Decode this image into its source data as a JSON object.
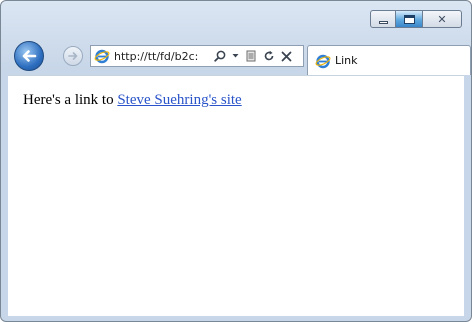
{
  "browser": {
    "address": {
      "url": "http://tt/fd/b2c:"
    },
    "tab": {
      "title": "Link"
    },
    "icons": {
      "back": "back-arrow-icon",
      "forward": "forward-arrow-icon",
      "search": "search-icon",
      "dropdown": "chevron-down-icon",
      "compat": "compatibility-view-icon",
      "refresh": "refresh-icon",
      "stop": "stop-icon",
      "site": "ie-logo-icon"
    }
  },
  "page": {
    "text": "Here's a link to ",
    "link_text": "Steve Suehring's site",
    "link_color": "#2a54c9"
  }
}
